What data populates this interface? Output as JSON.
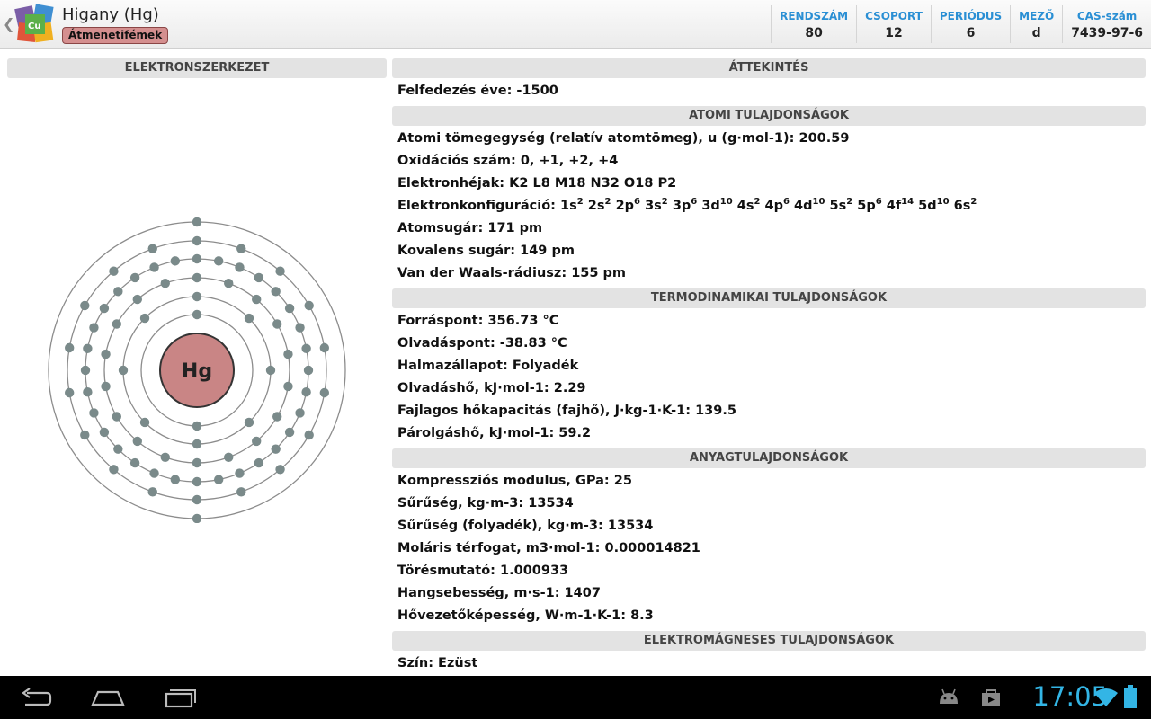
{
  "header": {
    "title": "Higany (Hg)",
    "category": "Átmenetifémek",
    "stats": [
      {
        "label": "RENDSZÁM",
        "value": "80"
      },
      {
        "label": "CSOPORT",
        "value": "12"
      },
      {
        "label": "PERIÓDUS",
        "value": "6"
      },
      {
        "label": "MEZŐ",
        "value": "d"
      },
      {
        "label": "CAS-szám",
        "value": "7439-97-6"
      }
    ]
  },
  "left": {
    "header": "ELEKTRONSZERKEZET",
    "nucleus_symbol": "Hg",
    "shells": [
      2,
      8,
      18,
      32,
      18,
      2
    ],
    "colors": {
      "nucleus": "#c98585",
      "electron": "#7a8a8a",
      "ring": "#8c8c8c"
    }
  },
  "sections": [
    {
      "header": "ÁTTEKINTÉS",
      "props": [
        {
          "label": "Felfedezés éve",
          "value": "-1500"
        }
      ]
    },
    {
      "header": "ATOMI TULAJDONSÁGOK",
      "props": [
        {
          "label": "Atomi tömegegység (relatív atomtömeg), u (g·mol-1)",
          "value": "200.59"
        },
        {
          "label": "Oxidációs szám",
          "value": "0, +1, +2, +4"
        },
        {
          "label": "Elektronhéjak",
          "value": "K2 L8 M18 N32 O18 P2"
        },
        {
          "label": "Elektronkonfiguráció",
          "config": [
            {
              "o": "1s",
              "n": "2"
            },
            {
              "o": "2s",
              "n": "2"
            },
            {
              "o": "2p",
              "n": "6"
            },
            {
              "o": "3s",
              "n": "2"
            },
            {
              "o": "3p",
              "n": "6"
            },
            {
              "o": "3d",
              "n": "10"
            },
            {
              "o": "4s",
              "n": "2"
            },
            {
              "o": "4p",
              "n": "6"
            },
            {
              "o": "4d",
              "n": "10"
            },
            {
              "o": "5s",
              "n": "2"
            },
            {
              "o": "5p",
              "n": "6"
            },
            {
              "o": "4f",
              "n": "14"
            },
            {
              "o": "5d",
              "n": "10"
            },
            {
              "o": "6s",
              "n": "2"
            }
          ]
        },
        {
          "label": "Atomsugár",
          "value": "171 pm"
        },
        {
          "label": "Kovalens sugár",
          "value": "149 pm"
        },
        {
          "label": "Van der Waals-rádiusz",
          "value": "155 pm"
        }
      ]
    },
    {
      "header": "TERMODINAMIKAI TULAJDONSÁGOK",
      "props": [
        {
          "label": "Forráspont",
          "value": "356.73 °C"
        },
        {
          "label": "Olvadáspont",
          "value": "-38.83 °C"
        },
        {
          "label": "Halmazállapot",
          "value": "Folyadék"
        },
        {
          "label": "Olvadáshő, kJ·mol-1",
          "value": "2.29"
        },
        {
          "label": "Fajlagos hőkapacitás (fajhő), J·kg-1·K-1",
          "value": "139.5"
        },
        {
          "label": "Párolgáshő, kJ·mol-1",
          "value": "59.2"
        }
      ]
    },
    {
      "header": "ANYAGTULAJDONSÁGOK",
      "props": [
        {
          "label": "Kompressziós modulus, GPa",
          "value": "25"
        },
        {
          "label": "Sűrűség, kg·m-3",
          "value": "13534"
        },
        {
          "label": "Sűrűség (folyadék), kg·m-3",
          "value": "13534"
        },
        {
          "label": "Moláris térfogat, m3·mol-1",
          "value": "0.000014821"
        },
        {
          "label": "Törésmutató",
          "value": "1.000933"
        },
        {
          "label": "Hangsebesség, m·s-1",
          "value": "1407"
        },
        {
          "label": "Hővezetőképesség, W·m-1·K-1",
          "value": "8.3"
        }
      ]
    },
    {
      "header": "ELEKTROMÁGNESES TULAJDONSÁGOK",
      "props": [
        {
          "label": "Szín",
          "value": "Ezüst"
        }
      ]
    }
  ],
  "statusbar": {
    "time": "17:05",
    "icons": [
      "android-debug-icon",
      "shopping-bag-icon",
      "wifi-icon",
      "battery-icon"
    ]
  },
  "navbar": {
    "buttons": [
      "back-icon",
      "home-icon",
      "recent-apps-icon"
    ]
  },
  "colors": {
    "accent": "#33b5e5",
    "stat_label": "#2a8fd4",
    "badge": "#d48f8f"
  }
}
